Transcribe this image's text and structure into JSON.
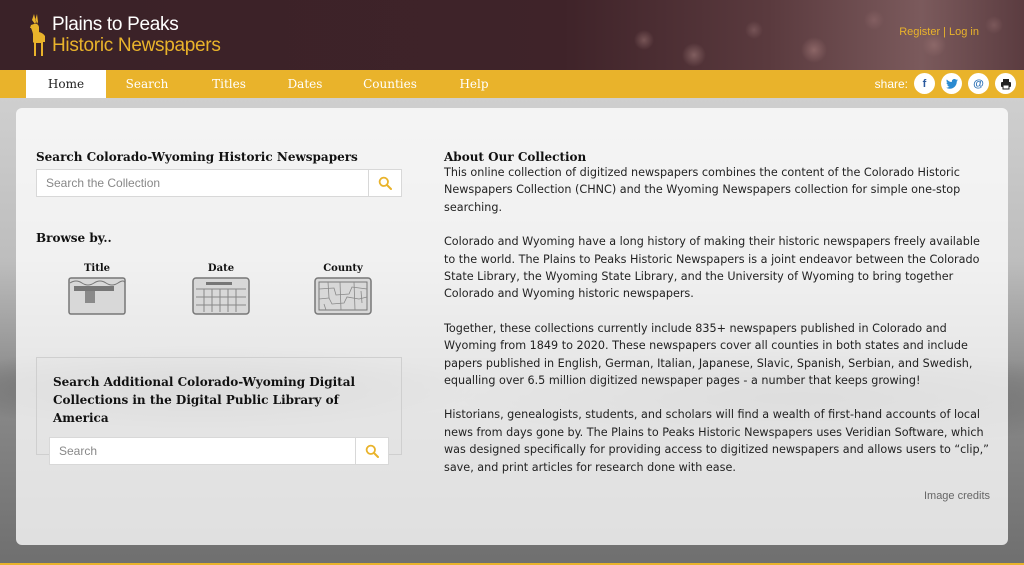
{
  "header": {
    "logo_line1": "Plains to Peaks",
    "logo_line2": "Historic Newspapers",
    "register_label": "Register",
    "separator": "|",
    "login_label": "Log in"
  },
  "nav": {
    "tabs": [
      {
        "label": "Home"
      },
      {
        "label": "Search"
      },
      {
        "label": "Titles"
      },
      {
        "label": "Dates"
      },
      {
        "label": "Counties"
      },
      {
        "label": "Help"
      }
    ],
    "share_label": "share:",
    "share_buttons": {
      "facebook": "f",
      "twitter": "t",
      "email": "@",
      "print": ""
    }
  },
  "left": {
    "search_title": "Search Colorado-Wyoming Historic Newspapers",
    "search_placeholder": "Search the Collection",
    "browse_title": "Browse by..",
    "browse_items": [
      {
        "label": "Title"
      },
      {
        "label": "Date"
      },
      {
        "label": "County"
      }
    ],
    "dpla_title": "Search Additional Colorado-Wyoming Digital Collections in the Digital Public Library of America",
    "dpla_placeholder": "Search"
  },
  "about": {
    "title": "About Our Collection",
    "paragraphs": [
      "This online collection of digitized newspapers combines the content of the Colorado Historic Newspapers Collection (CHNC) and the Wyoming Newspapers collection for simple one-stop searching.",
      "Colorado and Wyoming have a long history of making their historic newspapers freely available to the world. The Plains to Peaks Historic Newspapers is a joint endeavor between the Colorado State Library, the Wyoming State Library, and the University of Wyoming to bring together Colorado and Wyoming historic newspapers.",
      "Together, these collections currently include 835+ newspapers published in Colorado and Wyoming from 1849 to 2020. These newspapers cover all counties in both states and include papers published in English, German, Italian, Japanese, Slavic, Spanish, Serbian, and Swedish, equalling over 6.5 million digitized newspaper pages - a number that keeps growing!",
      "Historians, genealogists, students, and scholars will find a wealth of first-hand accounts of local news from days gone by. The Plains to Peaks Historic Newspapers uses Veridian Software, which was designed specifically for providing access to digitized newspapers and allows users to “clip,” save, and print articles for research done with ease."
    ],
    "image_credits": "Image credits"
  },
  "colors": {
    "accent": "#e9b32b",
    "header_bg": "#3f2329"
  }
}
